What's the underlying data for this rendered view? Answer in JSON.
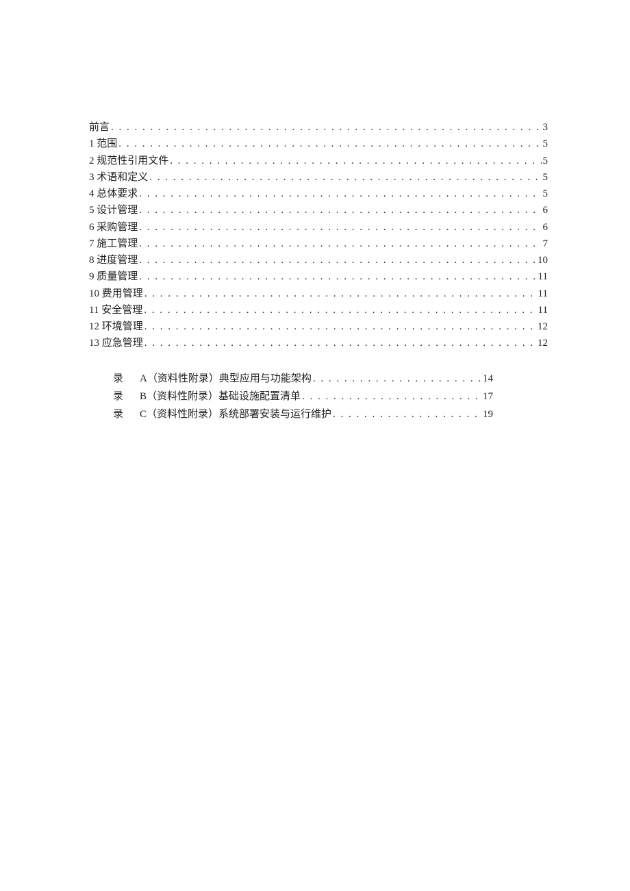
{
  "toc": {
    "items": [
      {
        "label": "前言",
        "page": "3"
      },
      {
        "label": "1 范围",
        "page": "5"
      },
      {
        "label": "2 规范性引用文件",
        "page": "5"
      },
      {
        "label": "3 术语和定义",
        "page": "5"
      },
      {
        "label": "4 总体要求",
        "page": "5"
      },
      {
        "label": "5 设计管理",
        "page": "6"
      },
      {
        "label": "6 采购管理",
        "page": "6"
      },
      {
        "label": "7 施工管理",
        "page": "7"
      },
      {
        "label": "8 进度管理",
        "page": "10"
      },
      {
        "label": "9 质量管理",
        "page": "11"
      },
      {
        "label": "10 费用管理",
        "page": "11"
      },
      {
        "label": "11 安全管理",
        "page": "11"
      },
      {
        "label": "12 环境管理",
        "page": "12"
      },
      {
        "label": "13 应急管理",
        "page": "12"
      }
    ]
  },
  "appendix": {
    "items": [
      {
        "prefix": "录",
        "label": "A（资料性附录）典型应用与功能架构",
        "page": "14"
      },
      {
        "prefix": "录",
        "label": "B（资料性附录）基础设施配置清单",
        "page": "17"
      },
      {
        "prefix": "录",
        "label": "C（资料性附录）系统部署安装与运行维护",
        "page": "19"
      }
    ]
  },
  "dots": ". . . . . . . . . . . . . . . . . . . . . . . . . . . . . . . . . . . . . . . . . . . . . . . . . . . . . . . . . . . . . . . . . . . . . . . . . . . . . . . . . . . . . . . . . . . . . . . . . . . . . . . . . . . ."
}
